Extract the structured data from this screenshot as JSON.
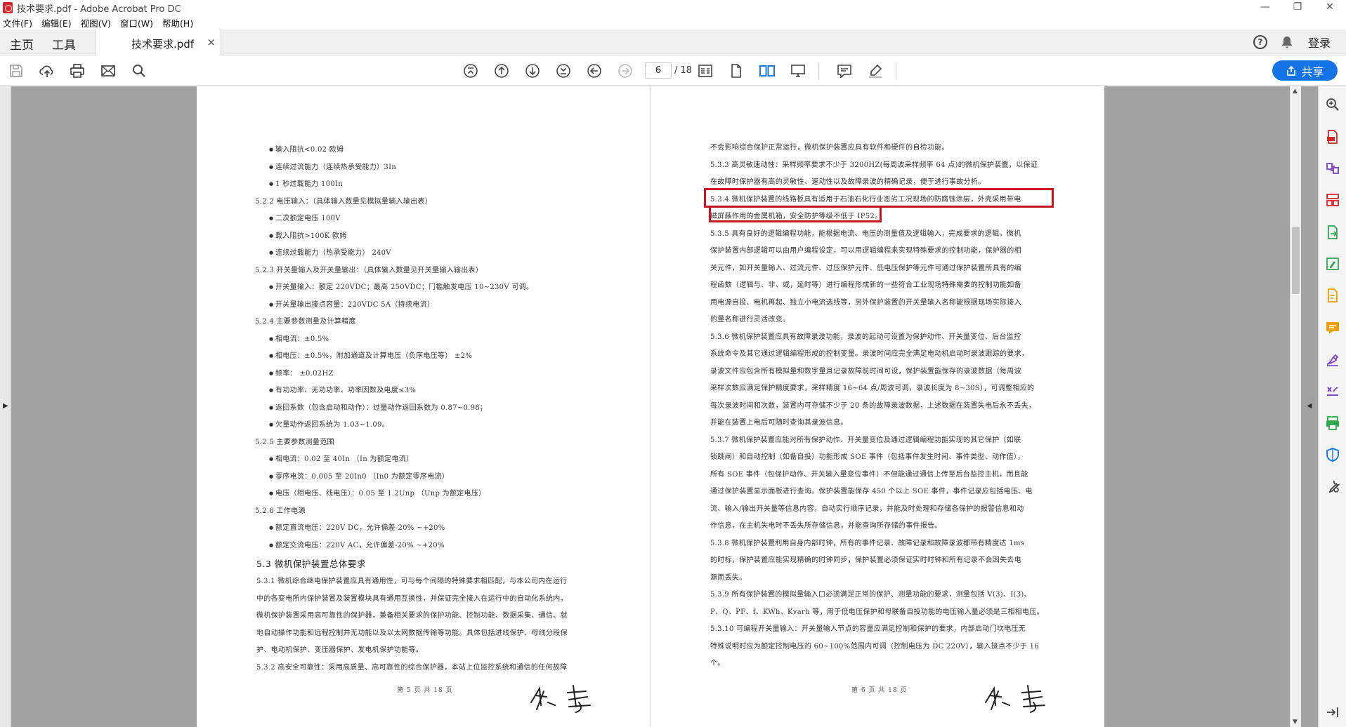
{
  "window": {
    "title": "技术要求.pdf - Adobe Acrobat Pro DC",
    "controls": [
      "—",
      "❐",
      "✕"
    ]
  },
  "menu": [
    "文件(F)",
    "编辑(E)",
    "视图(V)",
    "窗口(W)",
    "帮助(H)"
  ],
  "tabs": {
    "home": "主页",
    "tools": "工具",
    "document": "技术要求.pdf",
    "close": "×",
    "sign_in": "登录"
  },
  "toolbar": {
    "current_page": "6",
    "total_pages": "/ 18",
    "share": "共享"
  },
  "page_left": {
    "lines": [
      {
        "t": "输入阻抗<0.02 欧姆",
        "b": true
      },
      {
        "t": "连续过流能力（连续热承受能力）3In",
        "b": true
      },
      {
        "t": "1 秒过载能力   100In",
        "b": true
      },
      {
        "t": "5.2.2   电压输入：（具体输入数量见模拟量输入输出表）",
        "b": false
      },
      {
        "t": "二次额定电压  100V",
        "b": true
      },
      {
        "t": "载入阻抗>100K 欧姆",
        "b": true
      },
      {
        "t": "连续过载能力（热承受能力） 240V",
        "b": true
      },
      {
        "t": "5.2.3   开关量输入及开关量输出：（具体输入数量见开关量输入输出表）",
        "b": false
      },
      {
        "t": "开关量输入：额定 220VDC；最高 250VDC；门槛触发电压 10~230V 可调。",
        "b": true
      },
      {
        "t": "开关量输出接点容量：220VDC   5A（持续电流）",
        "b": true
      },
      {
        "t": "5.2.4   主要参数测量及计算精度",
        "b": false
      },
      {
        "t": "相电流：±0.5%",
        "b": true
      },
      {
        "t": "相电压：±0.5%，附加通道及计算电压（负序电压等） ±2%",
        "b": true
      },
      {
        "t": "频率：     ±0.02HZ",
        "b": true
      },
      {
        "t": "有功功率、无功功率、功率因数及电度≤3%",
        "b": true
      },
      {
        "t": "返回系数（包含启动和动作）：过量动作返回系数为 0.87~0.98；",
        "b": true
      },
      {
        "t": "欠量动作返回系统为 1.03~1.09。",
        "b": true
      },
      {
        "t": "5.2.5   主要参数测量范围",
        "b": false
      },
      {
        "t": "相电流：0.02 至 40In   （In 为额定电流）",
        "b": true
      },
      {
        "t": "零序电流：0.005 至 20In0   （In0 为额定零序电流）",
        "b": true
      },
      {
        "t": "电压（相电压、线电压）：0.05 至 1.2Unp  （Unp 为额定电压）",
        "b": true
      },
      {
        "t": "5.2.6   工作电源",
        "b": false
      },
      {
        "t": "额定直流电压：220V   DC，允许偏差-20%  ~+20%",
        "b": true
      },
      {
        "t": "额定交流电压：220V   AC，允许偏差-20%  ~+20%",
        "b": true
      }
    ],
    "heading": "5.3   微机保护装置总体要求",
    "para": [
      "5.3.1 微机综合继电保护装置应具有通用性，可与每个间隔的特殊要求相匹配，与本公司内在运行",
      "中的各变电所内保护装置及装置模块具有通用互换性，并保证完全接入在运行中的自动化系统内，",
      "微机保护装置采用高可靠性的保护器，兼备相关要求的保护功能、控制功能、数据采集、通信、就",
      "地自动操作功能和远程控制并无功能以及以太网数据传输等功能。具体包括进线保护、母线分段保",
      "护、电动机保护、变压器保护、发电机保护功能等。",
      "5.3.2 高安全可靠性：采用高质量、高可靠性的综合保护器，本站上位监控系统和通信的任何故障"
    ],
    "footer": "第 5 页 共 18 页"
  },
  "page_right": {
    "para": [
      "不会影响综合保护正常运行，微机保护装置应具有软件和硬件的自检功能。",
      "5.3.3 高灵敏速动性：采样频率要求不少于 3200HZ(每周波采样频率 64 点)的微机保护装置，以保证",
      "在故障时保护器有高的灵敏性、速动性以及故障录波的精确记录，便于进行事故分析。",
      "5.3.4 微机保护装置的线路板具有适用于石油石化行业恶劣工况现场的防腐蚀涂层，外壳采用带电",
      "磁屏蔽作用的金属机箱，安全防护等级不低于 IP52。",
      "5.3.5 具有良好的逻辑编程功能，能根据电流、电压的测量值及逻辑输入，完成要求的逻辑。微机",
      "保护装置内部逻辑可以由用户编程设定，可以用逻辑编程来实现特殊要求的控制功能，保护器的相",
      "关元件，如开关量输入、过流元件、过压保护元件、低电压保护等元件可通过保护装置所具有的编",
      "程函数（逻辑与、非、或，延时等）进行编程形成新的一些符合工业现场特殊需要的控制功能如备",
      "用电源自投、电机再起、独立小电流选线等，另外保护装置的开关量输入名称能根据现场实际接入",
      "的量名称进行灵活改变。",
      "5.3.6 微机保护装置应具有故障录波功能，录波的起动可设置为保护动作、开关量变位、后台监控",
      "系统命令及其它通过逻辑编程形成的控制变量。录波时间应完全满足电动机启动时录波跟踪的要求，",
      "录波文件应包含所有模拟量和数字量且记录故障前时间可设，保护装置能保存的录波数据（每周波",
      "采样次数应满足保护精度要求，采样精度 16~64 点/周波可调，录波长度为 8~30S），可调整相应的",
      "每次录波时间和次数，装置内可存储不少于 20 条的故障录波数据，上述数据在装置失电后永不丢失，",
      "并能在装置上电后可随时查询其录波信息。",
      "5.3.7 微机保护装置应能对所有保护动作、开关量变位及通过逻辑编程功能实现的其它保护（如联",
      "锁跳闸）和自动控制（如备自投）功能形成 SOE 事件（包括事件发生时间、事件类型、动作值），",
      "所有 SOE 事件（包保护动作、开关输入量变位事件）不但能通过通信上传至后台监控主机，而且能",
      "通过保护装置显示面板进行查询。保护装置能保存 450 个以上 SOE 事件，事件记录应包括电压、电",
      "流、输入/输出开关量等信息内容，自动实行顺序记录，并能及时处理和存储各保护的报警信息和动",
      "作信息，在主机失电时不丢失所存储信息，并能查询所存储的事件报告。",
      "5.3.8 微机保护装置利用自身内部时钟，所有的事件记录、故障记录和故障录波都带有精度达 1ms",
      "的时标，保护装置应能实现精确的时钟同步，保护装置必须保证实时时钟和所有记录不会因失去电",
      "源而丢失。",
      "5.3.9 所有保护装置的模拟量输入口必须满足正常的保护、测量功能的要求，测量包括 V(3)、I(3)、",
      "P、Q、PF、f、KWh、Kvarh 等，用于低电压保护和母联备自投功能的电压输入量必须是三相相电压。",
      "5.3.10 可编程开关量输入：开关量输入节点的容量应满足控制和保护的要求，内部启动门坎电压无",
      "特殊说明时应为额定控制电压的 60~100%范围内可调（控制电压为 DC 220V），输入接点不少于 16",
      "个。"
    ],
    "footer": "第 6 页 共 18 页"
  },
  "icons": {
    "toolbar": [
      "save-icon",
      "upload-icon",
      "print-icon",
      "mail-icon",
      "search-icon",
      "first-page-icon",
      "prev-page-icon",
      "next-page-icon",
      "last-page-icon",
      "back-icon",
      "forward-icon",
      "reader-icon",
      "single-page-icon",
      "two-page-icon",
      "monitor-icon",
      "comment-icon",
      "highlight-icon"
    ],
    "toolpane": [
      "zoom-icon",
      "create-pdf-icon",
      "combine-icon",
      "organize-icon",
      "export-icon",
      "edit-icon",
      "fill-sign-icon",
      "comment-icon",
      "sign-icon",
      "stamp-icon",
      "print-production-icon",
      "protect-icon",
      "more-tools-icon"
    ]
  },
  "colors": {
    "accent": "#1473e6",
    "highlight_box": "#c8151f",
    "tool_red": "#d9252a",
    "tool_green": "#2fa84f",
    "tool_blue": "#1473e6",
    "tool_purple": "#7a3fc6",
    "tool_orange": "#f0a000"
  }
}
